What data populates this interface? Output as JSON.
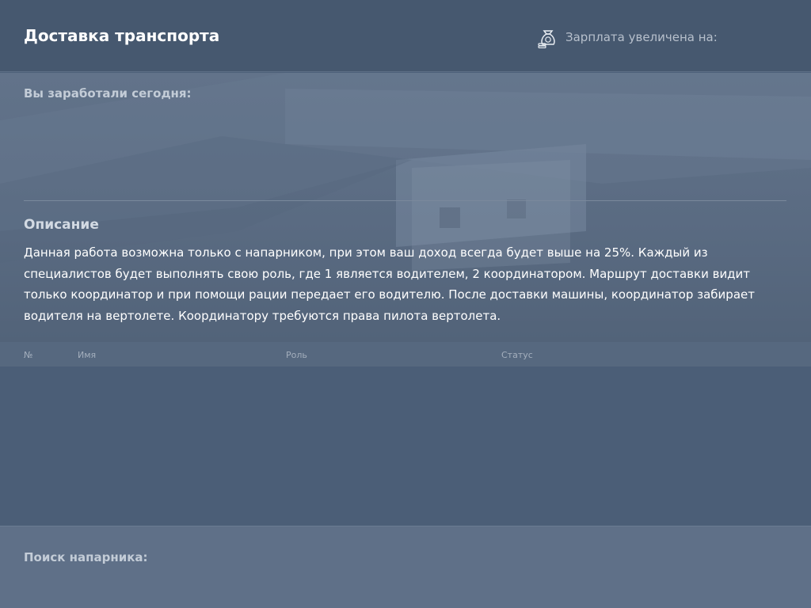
{
  "header": {
    "title": "Доставка транспорта",
    "salary_label": "Зарплата увеличена на:",
    "salary_icon": "money-bag-icon"
  },
  "earnings": {
    "label": "Вы заработали сегодня:"
  },
  "description": {
    "title": "Описание",
    "text": "Данная работа возможна только с напарником, при этом ваш доход всегда будет выше на 25%. Каждый из специалистов будет выполнять свою роль, где 1 является водителем, 2 координатором. Маршрут доставки видит только координатор и при помощи рации передает его водителю. После доставки машины, координатор забирает водителя на вертолете. Координатору требуются права пилота вертолета."
  },
  "table": {
    "columns": [
      "№",
      "Имя",
      "Роль",
      "Статус"
    ],
    "rows": []
  },
  "partner_search": {
    "label": "Поиск напарника:"
  },
  "colors": {
    "background": "#4d6079",
    "header": "#46586f",
    "text": "#ffffff",
    "muted": "#b7c0cc"
  }
}
